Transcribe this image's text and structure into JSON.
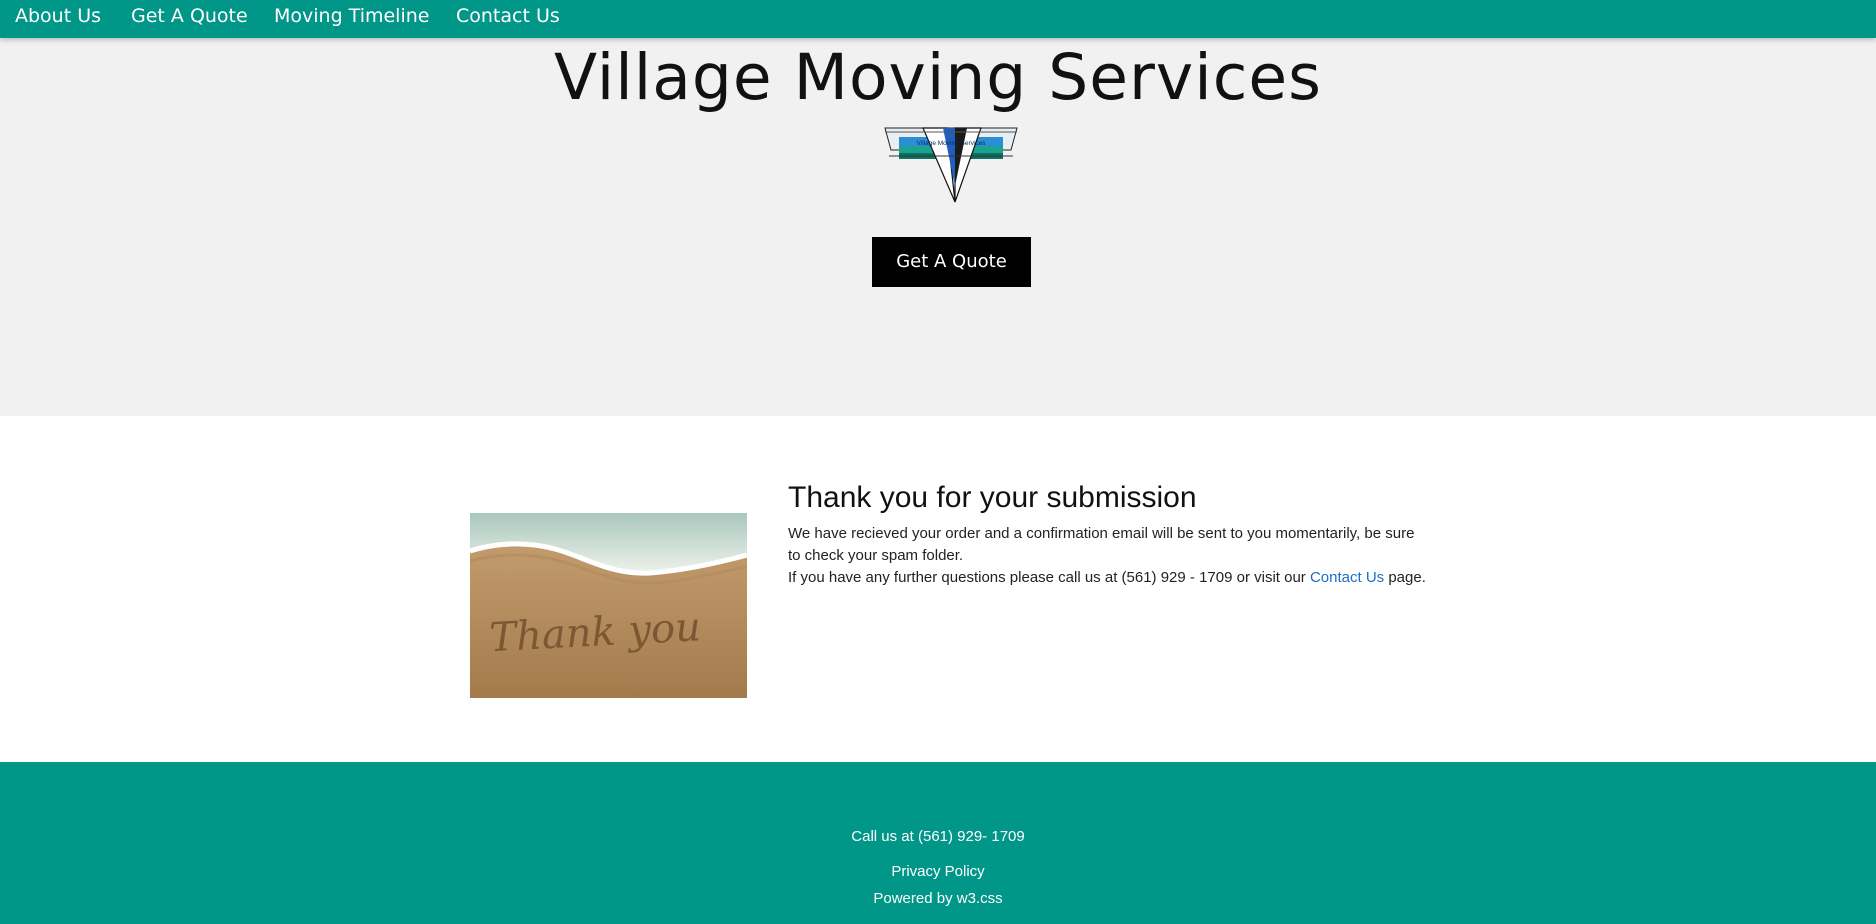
{
  "nav": {
    "items": [
      {
        "label": "About Us"
      },
      {
        "label": "Get A Quote"
      },
      {
        "label": "Moving Timeline"
      },
      {
        "label": "Contact Us"
      }
    ]
  },
  "hero": {
    "title": "Village Moving Services",
    "logo_text": "Village Moving Services",
    "cta_label": "Get A Quote"
  },
  "confirmation": {
    "image_text": "Thank you",
    "heading": "Thank you for your submission",
    "line1": "We have recieved your order and a confirmation email will be sent to you momentarily, be sure to check your spam folder.",
    "line2_prefix": "If you have any further questions please call us at (561) 929 - 1709 or visit our ",
    "line2_link": "Contact Us",
    "line2_suffix": " page."
  },
  "footer": {
    "call": "Call us at (561) 929- 1709",
    "privacy": "Privacy Policy",
    "powered_prefix": "Powered by ",
    "powered_link": "w3.css"
  },
  "colors": {
    "brand_teal": "#009688",
    "hero_bg": "#f1f1f1",
    "link_blue": "#1a6fc9"
  }
}
